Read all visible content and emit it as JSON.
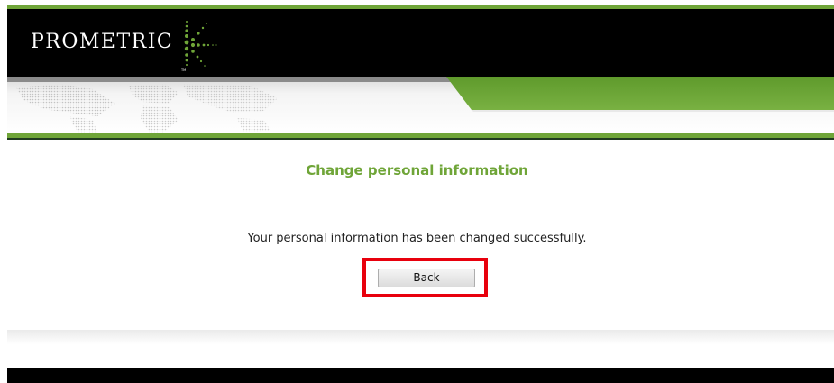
{
  "header": {
    "logo_text": "PROMETRIC",
    "logo_icon": "prometric-dots-logo-icon",
    "trademark": "TM"
  },
  "main": {
    "title": "Change personal information",
    "message": "Your personal information has been changed successfully.",
    "back_label": "Back"
  },
  "colors": {
    "brand_green": "#6fa538",
    "header_black": "#000000",
    "highlight_red": "#e8000d"
  }
}
